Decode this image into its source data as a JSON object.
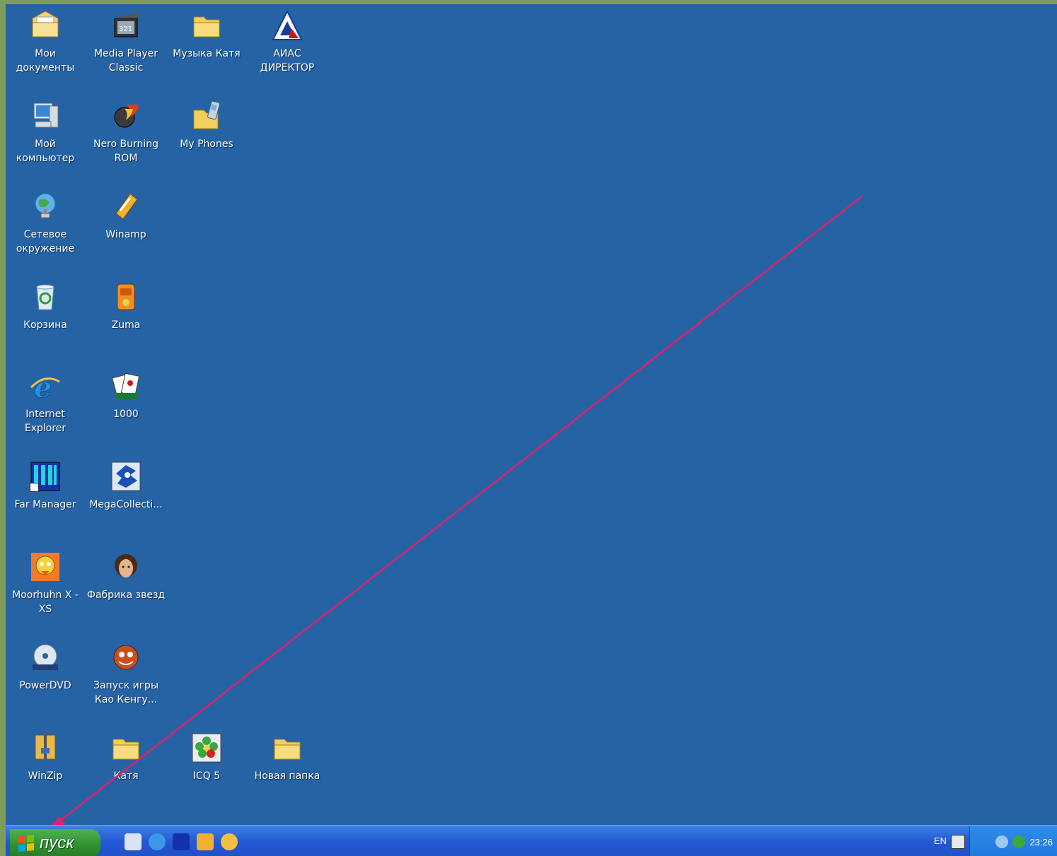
{
  "desktop": {
    "icons": [
      {
        "label": "Мои документы",
        "icon": "my-documents-icon"
      },
      {
        "label": "Media Player Classic",
        "icon": "media-player-icon"
      },
      {
        "label": "Музыка Катя",
        "icon": "folder-icon"
      },
      {
        "label": "АИАС ДИРЕКТОР",
        "icon": "aias-icon"
      },
      {
        "label": "Мой компьютер",
        "icon": "my-computer-icon"
      },
      {
        "label": "Nero Burning ROM",
        "icon": "nero-icon"
      },
      {
        "label": "My Phones",
        "icon": "phones-folder-icon"
      },
      {
        "label": "Сетевое окружение",
        "icon": "network-icon"
      },
      {
        "label": "Winamp",
        "icon": "winamp-icon"
      },
      {
        "label": "Корзина",
        "icon": "recycle-bin-icon"
      },
      {
        "label": "Zuma",
        "icon": "zuma-icon"
      },
      {
        "label": "Internet Explorer",
        "icon": "internet-explorer-icon"
      },
      {
        "label": "1000",
        "icon": "cards-game-icon"
      },
      {
        "label": "Far Manager",
        "icon": "far-manager-icon"
      },
      {
        "label": "MegaCollecti...",
        "icon": "sonic-icon"
      },
      {
        "label": "Moorhuhn X - XS",
        "icon": "moorhuhn-icon"
      },
      {
        "label": "Фабрика звезд",
        "icon": "star-factory-icon"
      },
      {
        "label": "PowerDVD",
        "icon": "powerdvd-icon"
      },
      {
        "label": "Запуск игры Кao Кенгу...",
        "icon": "kao-kangaroo-icon"
      },
      {
        "label": "WinZip",
        "icon": "winzip-icon"
      },
      {
        "label": "Катя",
        "icon": "folder-icon"
      },
      {
        "label": "ICQ 5",
        "icon": "icq-icon"
      },
      {
        "label": "Новая папка",
        "icon": "folder-icon"
      }
    ]
  },
  "taskbar": {
    "start_label": "пуск",
    "quick_launch": [
      "show-desktop-icon",
      "internet-explorer-icon",
      "far-manager-icon",
      "winamp-icon",
      "media-icon"
    ],
    "language": "EN",
    "clock": "23:26"
  },
  "colors": {
    "desktop": "#2563a4",
    "arrow": "#e0206e",
    "taskbar": "#2458d4",
    "start": "#2e8f2e"
  }
}
